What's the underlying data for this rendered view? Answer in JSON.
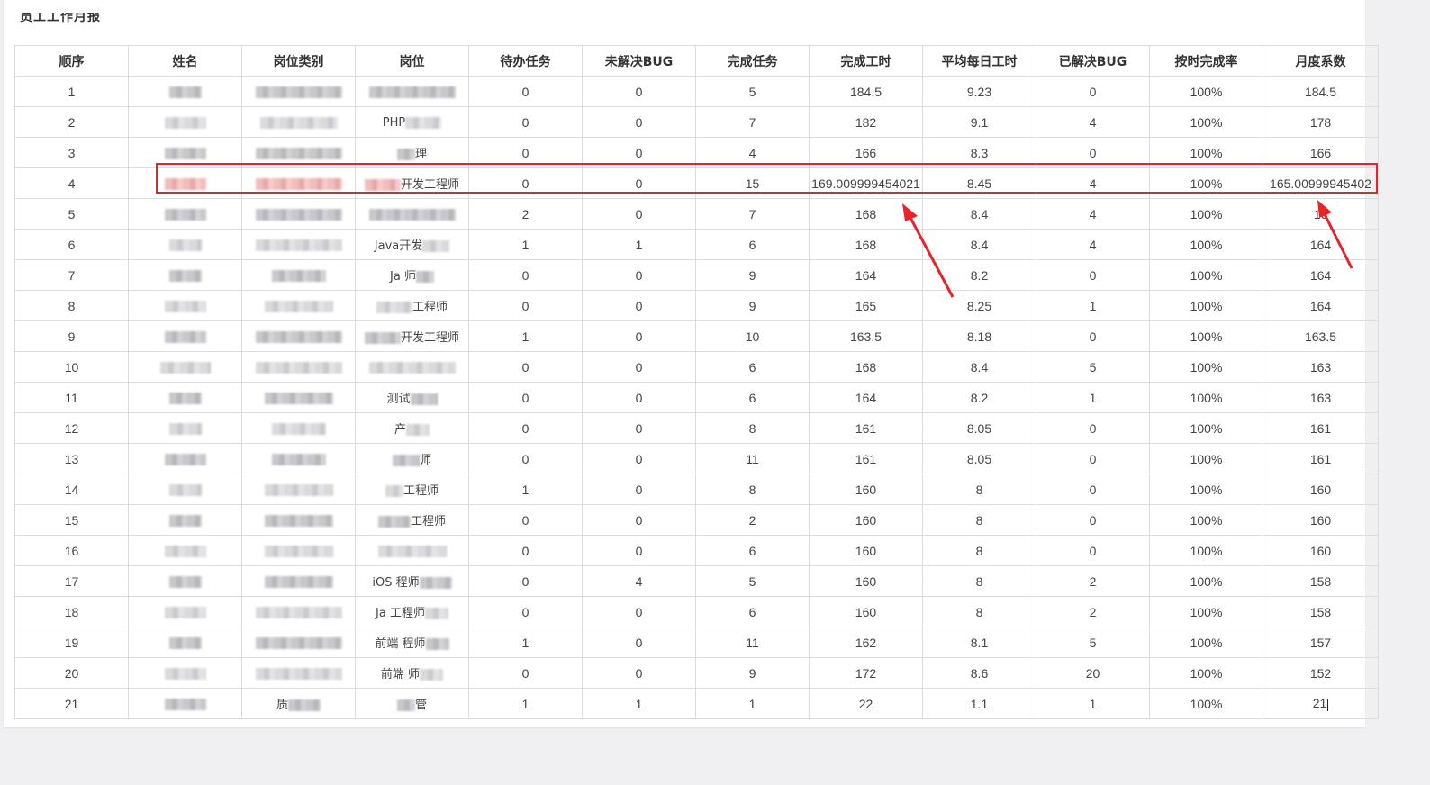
{
  "page": {
    "title": "员工工作月报"
  },
  "table": {
    "headers": [
      "顺序",
      "姓名",
      "岗位类别",
      "岗位",
      "待办任务",
      "未解决BUG",
      "完成任务",
      "完成工时",
      "平均每日工时",
      "已解决BUG",
      "按时完成率",
      "月度系数"
    ],
    "rows": [
      {
        "order": "1",
        "category_frag": "",
        "position_frag": "",
        "pending": "0",
        "open_bugs": "0",
        "done": "5",
        "hours": "184.5",
        "avg": "9.23",
        "solved": "0",
        "rate": "100%",
        "coef": "184.5"
      },
      {
        "order": "2",
        "category_frag": "",
        "position_frag": "PHP",
        "pending": "0",
        "open_bugs": "0",
        "done": "7",
        "hours": "182",
        "avg": "9.1",
        "solved": "4",
        "rate": "100%",
        "coef": "178"
      },
      {
        "order": "3",
        "category_frag": "",
        "position_frag": "理",
        "pending": "0",
        "open_bugs": "0",
        "done": "4",
        "hours": "166",
        "avg": "8.3",
        "solved": "0",
        "rate": "100%",
        "coef": "166"
      },
      {
        "order": "4",
        "category_frag": "",
        "position_frag": "开发工程师",
        "pending": "0",
        "open_bugs": "0",
        "done": "15",
        "hours": "169.009999454021",
        "avg": "8.45",
        "solved": "4",
        "rate": "100%",
        "coef": "165.00999945402"
      },
      {
        "order": "5",
        "category_frag": "",
        "position_frag": "",
        "pending": "2",
        "open_bugs": "0",
        "done": "7",
        "hours": "168",
        "avg": "8.4",
        "solved": "4",
        "rate": "100%",
        "coef": "16"
      },
      {
        "order": "6",
        "category_frag": "",
        "position_frag": "Java开发",
        "pending": "1",
        "open_bugs": "1",
        "done": "6",
        "hours": "168",
        "avg": "8.4",
        "solved": "4",
        "rate": "100%",
        "coef": "164"
      },
      {
        "order": "7",
        "category_frag": "",
        "position_frag": "Ja 师",
        "pending": "0",
        "open_bugs": "0",
        "done": "9",
        "hours": "164",
        "avg": "8.2",
        "solved": "0",
        "rate": "100%",
        "coef": "164"
      },
      {
        "order": "8",
        "category_frag": "",
        "position_frag": "工程师",
        "pending": "0",
        "open_bugs": "0",
        "done": "9",
        "hours": "165",
        "avg": "8.25",
        "solved": "1",
        "rate": "100%",
        "coef": "164"
      },
      {
        "order": "9",
        "category_frag": "",
        "position_frag": "开发工程师",
        "pending": "1",
        "open_bugs": "0",
        "done": "10",
        "hours": "163.5",
        "avg": "8.18",
        "solved": "0",
        "rate": "100%",
        "coef": "163.5"
      },
      {
        "order": "10",
        "category_frag": "",
        "position_frag": "",
        "pending": "0",
        "open_bugs": "0",
        "done": "6",
        "hours": "168",
        "avg": "8.4",
        "solved": "5",
        "rate": "100%",
        "coef": "163"
      },
      {
        "order": "11",
        "category_frag": "",
        "position_frag": "测试",
        "pending": "0",
        "open_bugs": "0",
        "done": "6",
        "hours": "164",
        "avg": "8.2",
        "solved": "1",
        "rate": "100%",
        "coef": "163"
      },
      {
        "order": "12",
        "category_frag": "",
        "position_frag": "产",
        "pending": "0",
        "open_bugs": "0",
        "done": "8",
        "hours": "161",
        "avg": "8.05",
        "solved": "0",
        "rate": "100%",
        "coef": "161"
      },
      {
        "order": "13",
        "category_frag": "",
        "position_frag": "师",
        "pending": "0",
        "open_bugs": "0",
        "done": "11",
        "hours": "161",
        "avg": "8.05",
        "solved": "0",
        "rate": "100%",
        "coef": "161"
      },
      {
        "order": "14",
        "category_frag": "",
        "position_frag": "工程师",
        "pending": "1",
        "open_bugs": "0",
        "done": "8",
        "hours": "160",
        "avg": "8",
        "solved": "0",
        "rate": "100%",
        "coef": "160"
      },
      {
        "order": "15",
        "category_frag": "",
        "position_frag": "工程师",
        "pending": "0",
        "open_bugs": "0",
        "done": "2",
        "hours": "160",
        "avg": "8",
        "solved": "0",
        "rate": "100%",
        "coef": "160"
      },
      {
        "order": "16",
        "category_frag": "",
        "position_frag": "",
        "pending": "0",
        "open_bugs": "0",
        "done": "6",
        "hours": "160",
        "avg": "8",
        "solved": "0",
        "rate": "100%",
        "coef": "160"
      },
      {
        "order": "17",
        "category_frag": "",
        "position_frag": "iOS 程师",
        "pending": "0",
        "open_bugs": "4",
        "done": "5",
        "hours": "160",
        "avg": "8",
        "solved": "2",
        "rate": "100%",
        "coef": "158"
      },
      {
        "order": "18",
        "category_frag": "",
        "position_frag": "Ja 工程师",
        "pending": "0",
        "open_bugs": "0",
        "done": "6",
        "hours": "160",
        "avg": "8",
        "solved": "2",
        "rate": "100%",
        "coef": "158"
      },
      {
        "order": "19",
        "category_frag": "",
        "position_frag": "前端 程师",
        "pending": "1",
        "open_bugs": "0",
        "done": "11",
        "hours": "162",
        "avg": "8.1",
        "solved": "5",
        "rate": "100%",
        "coef": "157"
      },
      {
        "order": "20",
        "category_frag": "",
        "position_frag": "前端 师",
        "pending": "0",
        "open_bugs": "0",
        "done": "9",
        "hours": "172",
        "avg": "8.6",
        "solved": "20",
        "rate": "100%",
        "coef": "152"
      },
      {
        "order": "21",
        "category_frag": "质",
        "position_frag": "管",
        "pending": "1",
        "open_bugs": "1",
        "done": "1",
        "hours": "22",
        "avg": "1.1",
        "solved": "1",
        "rate": "100%",
        "coef": "21"
      }
    ]
  },
  "annotation": {
    "highlight_color": "#e8242a",
    "highlighted_row": "4"
  }
}
